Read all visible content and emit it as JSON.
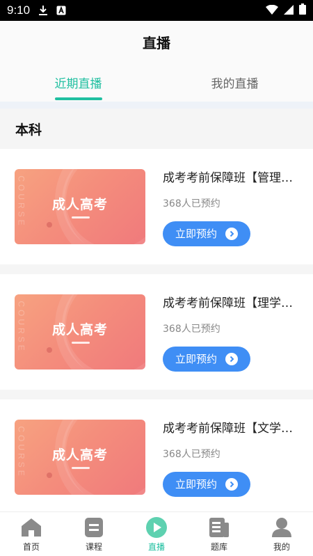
{
  "status_bar": {
    "time": "9:10"
  },
  "header": {
    "title": "直播"
  },
  "tabs": [
    {
      "label": "近期直播",
      "active": true
    },
    {
      "label": "我的直播",
      "active": false
    }
  ],
  "section": {
    "title": "本科"
  },
  "courses": [
    {
      "thumb_label": "成人高考",
      "thumb_side_text": "COURSE",
      "title": "成考考前保障班【管理…",
      "count": "368人已预约",
      "button": "立即预约"
    },
    {
      "thumb_label": "成人高考",
      "thumb_side_text": "COURSE",
      "title": "成考考前保障班【理学…",
      "count": "368人已预约",
      "button": "立即预约"
    },
    {
      "thumb_label": "成人高考",
      "thumb_side_text": "COURSE",
      "title": "成考考前保障班【文学…",
      "count": "368人已预约",
      "button": "立即预约"
    }
  ],
  "bottom_nav": [
    {
      "label": "首页",
      "icon": "home-icon"
    },
    {
      "label": "课程",
      "icon": "course-icon"
    },
    {
      "label": "直播",
      "icon": "live-play-icon",
      "active": true
    },
    {
      "label": "题库",
      "icon": "question-bank-icon"
    },
    {
      "label": "我的",
      "icon": "profile-icon"
    }
  ],
  "colors": {
    "accent": "#1fbfa0",
    "button": "#3f8ef5",
    "thumb_gradient": "#f48c7c"
  }
}
